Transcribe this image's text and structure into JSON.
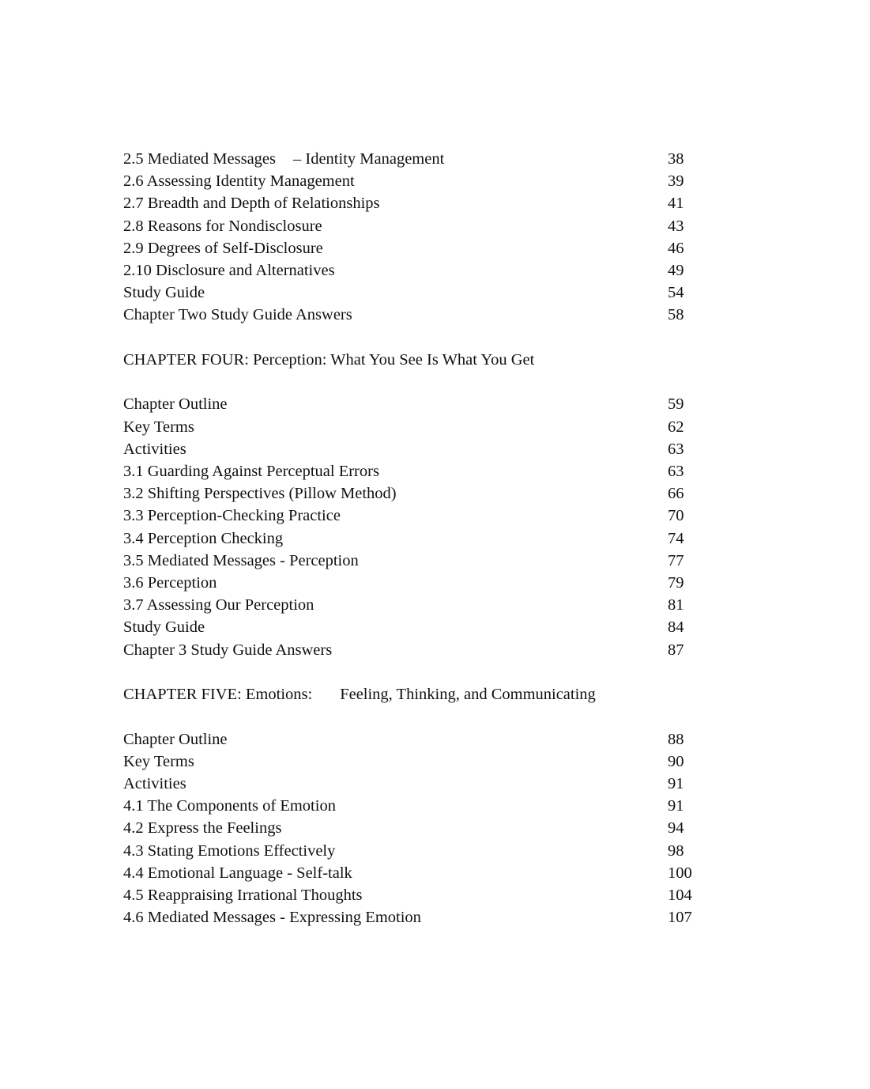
{
  "sections": [
    {
      "heading": null,
      "entries": [
        {
          "title_a": "2.5 Mediated Messages",
          "title_b": "– Identity Management",
          "page": "38"
        },
        {
          "title": "2.6 Assessing Identity Management",
          "page": "39"
        },
        {
          "title": "2.7 Breadth and Depth of Relationships",
          "page": "41"
        },
        {
          "title": "2.8 Reasons for Nondisclosure",
          "page": "43"
        },
        {
          "title": "2.9 Degrees of Self-Disclosure",
          "page": "46"
        },
        {
          "title": "2.10 Disclosure and Alternatives",
          "page": "49"
        },
        {
          "title": "Study Guide",
          "page": "54"
        },
        {
          "title": "Chapter Two Study Guide Answers",
          "page": "58"
        }
      ]
    },
    {
      "heading": "CHAPTER FOUR: Perception: What You See Is What You Get",
      "entries": [
        {
          "title": "Chapter Outline",
          "page": "59"
        },
        {
          "title": "Key Terms",
          "page": "62"
        },
        {
          "title": "Activities",
          "page": "63"
        },
        {
          "title": "3.1 Guarding Against Perceptual Errors",
          "page": "63"
        },
        {
          "title": "3.2 Shifting Perspectives (Pillow Method)",
          "page": "66"
        },
        {
          "title": "3.3 Perception-Checking Practice",
          "page": "70"
        },
        {
          "title": "3.4 Perception Checking",
          "page": "74"
        },
        {
          "title": "3.5 Mediated Messages - Perception",
          "page": "77"
        },
        {
          "title": "3.6 Perception",
          "page": "79"
        },
        {
          "title": "3.7 Assessing Our Perception",
          "page": "81"
        },
        {
          "title": "Study Guide",
          "page": "84"
        },
        {
          "title": "Chapter 3 Study Guide Answers",
          "page": "87"
        }
      ]
    },
    {
      "heading_a": "CHAPTER FIVE: Emotions:",
      "heading_b": "Feeling, Thinking, and Communicating",
      "entries": [
        {
          "title": "Chapter Outline",
          "page": "88"
        },
        {
          "title": "Key Terms",
          "page": "90"
        },
        {
          "title": "Activities",
          "page": "91"
        },
        {
          "title": "4.1 The Components of Emotion",
          "page": "91"
        },
        {
          "title": "4.2 Express the Feelings",
          "page": "94"
        },
        {
          "title": "4.3 Stating Emotions Effectively",
          "page": "98"
        },
        {
          "title": "4.4 Emotional Language - Self-talk",
          "page": "100"
        },
        {
          "title": "4.5 Reappraising Irrational Thoughts",
          "page": "104"
        },
        {
          "title": "4.6 Mediated Messages - Expressing Emotion",
          "page": "107"
        }
      ]
    }
  ]
}
